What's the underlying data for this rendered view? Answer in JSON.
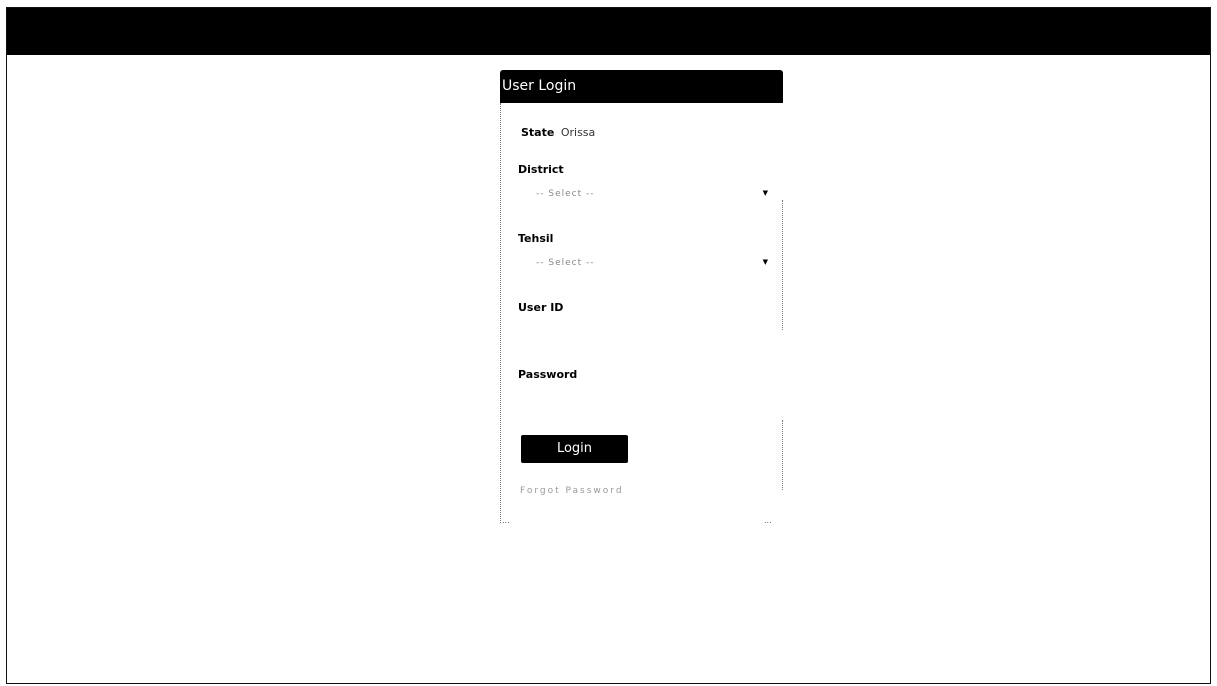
{
  "header": {
    "title": "User Login"
  },
  "form": {
    "state_label": "State",
    "state_value": "Orissa",
    "district_label": "District",
    "district_placeholder": "-- Select --",
    "tehsil_label": "Tehsil",
    "tehsil_placeholder": "-- Select --",
    "userid_label": "User ID",
    "userid_value": "",
    "password_label": "Password",
    "password_value": "",
    "login_label": "Login",
    "forgot_label": "Forgot Password"
  },
  "icons": {
    "district_caret": "chevron-down-icon",
    "tehsil_caret": "chevron-down-icon"
  },
  "colors": {
    "topbar": "#000000",
    "header_bg": "#000000",
    "button_bg": "#000000",
    "page_bg": "#ffffff"
  }
}
